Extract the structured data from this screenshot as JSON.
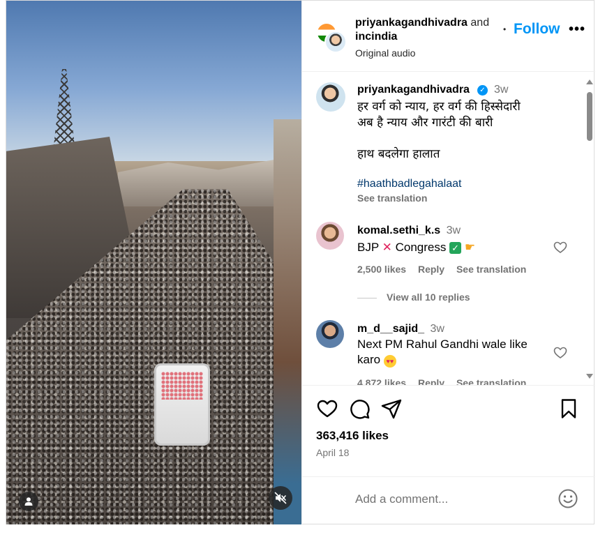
{
  "header": {
    "owner1": "priyankagandhivadra",
    "and_text": "and",
    "owner2": "incindia",
    "audio": "Original audio",
    "separator": "•",
    "follow_label": "Follow",
    "more_label": "•••"
  },
  "caption": {
    "username": "priyankagandhivadra",
    "verified": "✓",
    "time": "3w",
    "line1": "हर वर्ग को न्याय, हर वर्ग की हिस्सेदारी",
    "line2": "अब है न्याय और गारंटी की बारी",
    "line3": "हाथ बदलेगा हालात",
    "hashtag": "#haathbadlegahalaat",
    "see_translation": "See translation"
  },
  "comments": [
    {
      "username": "komal.sethi_k.s",
      "time": "3w",
      "text_a": "BJP",
      "text_b": "Congress",
      "likes": "2,500 likes",
      "reply": "Reply",
      "see_translation": "See translation"
    },
    {
      "username": "m_d__sajid_",
      "time": "3w",
      "text": "Next PM Rahul Gandhi wale like karo",
      "likes": "4,872 likes",
      "reply": "Reply",
      "see_translation": "See translation"
    }
  ],
  "view_replies": "View all 10 replies",
  "stats": {
    "likes": "363,416 likes",
    "date": "April 18"
  },
  "composer": {
    "placeholder": "Add a comment..."
  },
  "icons": {
    "like": "heart-icon",
    "comment": "comment-icon",
    "share": "share-icon",
    "save": "bookmark-icon",
    "emoji": "emoji-icon",
    "mute": "muted-speaker-icon",
    "tag": "person-icon"
  },
  "colors": {
    "accent": "#0095f6",
    "hashtag": "#00376b",
    "muted": "#737373"
  }
}
